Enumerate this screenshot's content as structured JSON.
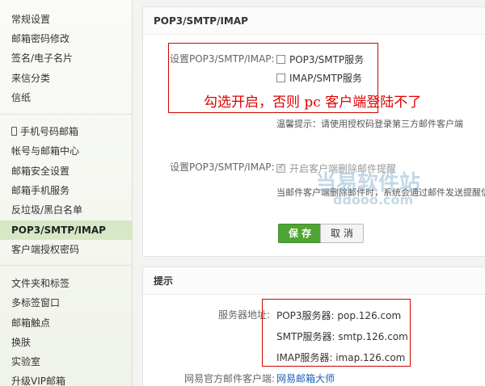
{
  "sidebar": {
    "items": [
      {
        "label": "常规设置"
      },
      {
        "label": "邮箱密码修改"
      },
      {
        "label": "签名/电子名片"
      },
      {
        "label": "来信分类"
      },
      {
        "label": "信纸"
      },
      {
        "label": "手机号码邮箱"
      },
      {
        "label": "帐号与邮箱中心"
      },
      {
        "label": "邮箱安全设置"
      },
      {
        "label": "邮箱手机服务"
      },
      {
        "label": "反垃圾/黑白名单"
      },
      {
        "label": "POP3/SMTP/IMAP"
      },
      {
        "label": "客户端授权密码"
      },
      {
        "label": "文件夹和标签"
      },
      {
        "label": "多标签窗口"
      },
      {
        "label": "邮箱触点"
      },
      {
        "label": "换肤"
      },
      {
        "label": "实验室"
      },
      {
        "label": "升级VIP邮箱"
      }
    ]
  },
  "settings_panel": {
    "title": "POP3/SMTP/IMAP",
    "row1_label": "设置POP3/SMTP/IMAP:",
    "opt_pop3": "POP3/SMTP服务",
    "opt_imap": "IMAP/SMTP服务",
    "annotation": "勾选开启，否则 pc 客户端登陆不了",
    "tip": "温馨提示：请使用授权码登录第三方邮件客户端",
    "row2_label": "设置POP3/SMTP/IMAP:",
    "opt_delete_notice": "开启客户端删除邮件提醒",
    "delete_desc": "当邮件客户端删除邮件时，系统会通过邮件发送提醒信息",
    "save": "保 存",
    "cancel": "取 消"
  },
  "tips_panel": {
    "title": "提示",
    "server_label": "服务器地址:",
    "pop3": "POP3服务器: pop.126.com",
    "smtp": "SMTP服务器: smtp.126.com",
    "imap": "IMAP服务器: imap.126.com",
    "client_label": "网易官方邮件客户端:",
    "client_link": "网易邮箱大师"
  },
  "watermark": {
    "main": "当易软件站",
    "sub": "ddooo.com"
  },
  "colors": {
    "active_bg": "#d7e8c6",
    "save_green": "#4fa533",
    "annotation_red": "#e00000"
  }
}
